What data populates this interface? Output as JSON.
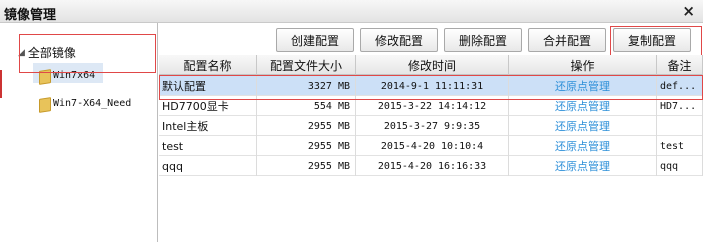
{
  "window": {
    "title": "镜像管理",
    "close_glyph": "×"
  },
  "sidebar": {
    "root_label": "全部镜像",
    "items": [
      {
        "label": "Win7x64",
        "icon": "folder-icon"
      },
      {
        "label": "Win7-X64_Need",
        "icon": "folder-icon"
      }
    ]
  },
  "toolbar": {
    "create": "创建配置",
    "edit": "修改配置",
    "delete": "删除配置",
    "merge": "合并配置",
    "copy": "复制配置"
  },
  "table": {
    "headers": {
      "name": "配置名称",
      "size": "配置文件大小",
      "time": "修改时间",
      "op": "操作",
      "note": "备注"
    },
    "rows": [
      {
        "name": "默认配置",
        "size": "3327 MB",
        "time": "2014-9-1 11:11:31",
        "op": "还原点管理",
        "note": "def..."
      },
      {
        "name": "HD7700显卡",
        "size": "554 MB",
        "time": "2015-3-22 14:14:12",
        "op": "还原点管理",
        "note": "HD7..."
      },
      {
        "name": "Intel主板",
        "size": "2955 MB",
        "time": "2015-3-27 9:9:35",
        "op": "还原点管理",
        "note": ""
      },
      {
        "name": "test",
        "size": "2955 MB",
        "time": "2015-4-20 10:10:4",
        "op": "还原点管理",
        "note": "test"
      },
      {
        "name": "qqq",
        "size": "2955 MB",
        "time": "2015-4-20 16:16:33",
        "op": "还原点管理",
        "note": "qqq"
      }
    ]
  },
  "colors": {
    "accent_link": "#2d8fd8",
    "highlight_red": "#e04848",
    "selected_row": "#cce0f7"
  }
}
